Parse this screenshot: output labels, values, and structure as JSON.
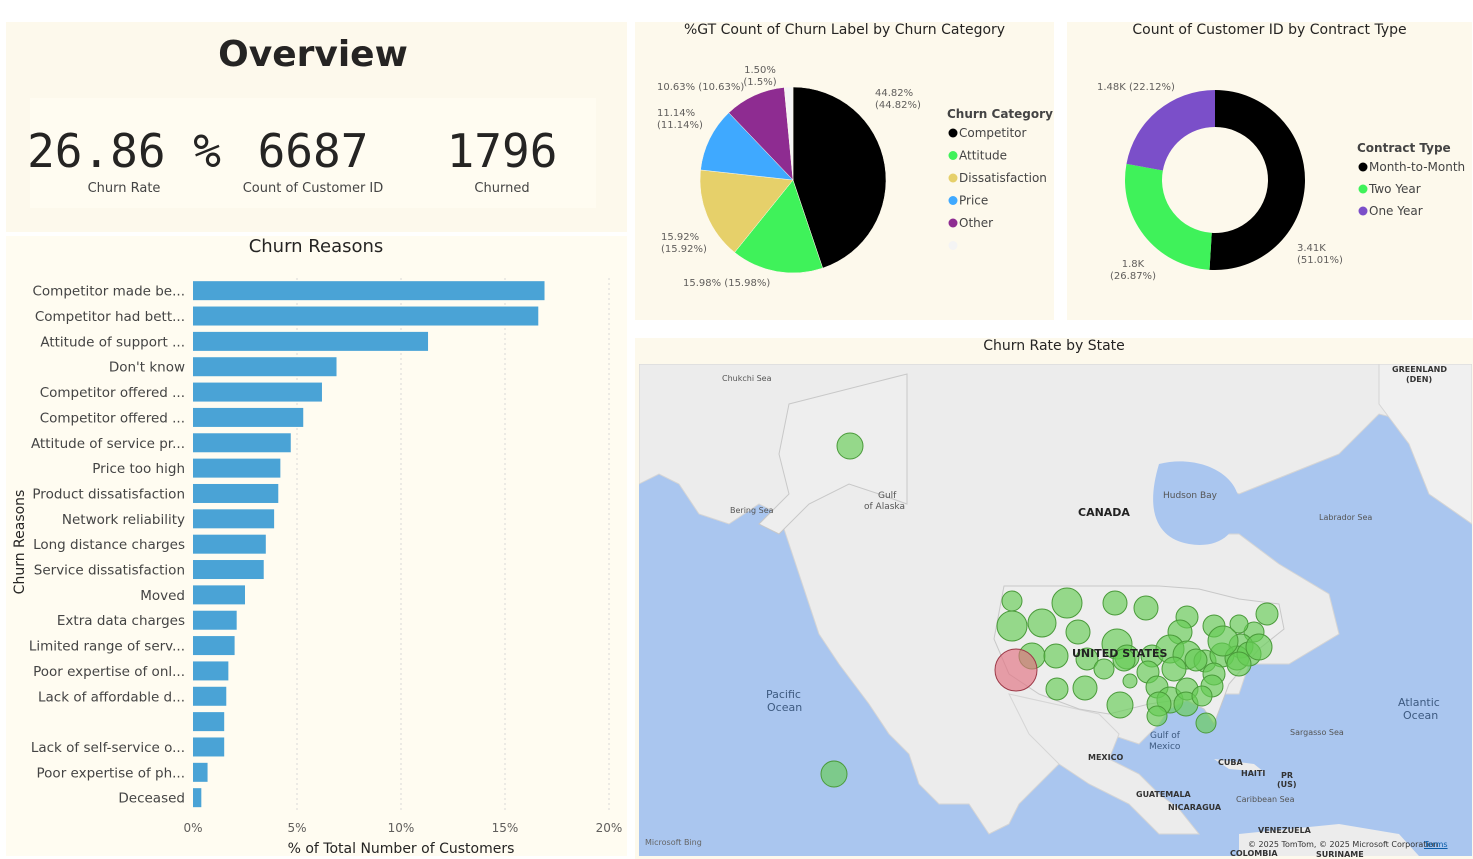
{
  "overview": {
    "title": "Overview",
    "kpis": [
      {
        "value": "26.86 %",
        "label": "Churn Rate"
      },
      {
        "value": "6687",
        "label": "Count of Customer ID"
      },
      {
        "value": "1796",
        "label": "Churned"
      }
    ]
  },
  "churn_reasons_chart": {
    "title": "Churn Reasons",
    "ylabel": "Churn Reasons",
    "xlabel": "% of Total Number of Customers",
    "color": "#4aa3d6"
  },
  "churn_category_chart": {
    "title": "%GT Count of Churn Label by Churn Category",
    "legend_title": "Churn Category"
  },
  "contract_chart": {
    "title": "Count of Customer ID by Contract Type",
    "legend_title": "Contract Type"
  },
  "map": {
    "title": "Churn Rate by State",
    "labels": {
      "chukchi": "Chukchi Sea",
      "greenland": "GREENLAND",
      "greenland2": "(DEN)",
      "gulf_alaska": "Gulf",
      "gulf_alaska2": "of Alaska",
      "bering": "Bering Sea",
      "hudson": "Hudson Bay",
      "canada": "CANADA",
      "labrador": "Labrador Sea",
      "us": "UNITED STATES",
      "pacific": "Pacific",
      "pacific2": "Ocean",
      "atlantic": "Atlantic",
      "atlantic2": "Ocean",
      "sargasso": "Sargasso Sea",
      "gulf_mexico": "Gulf of",
      "gulf_mexico2": "Mexico",
      "mexico": "MEXICO",
      "cuba": "CUBA",
      "haiti": "HAITI",
      "pr": "PR",
      "pr2": "(US)",
      "guatemala": "GUATEMALA",
      "nicaragua": "NICARAGUA",
      "caribbean": "Caribbean Sea",
      "venezuela": "VENEZUELA",
      "colombia": "COLOMBIA",
      "suriname": "SURINAME",
      "bing": "Microsoft Bing",
      "copyright": "© 2025 TomTom, © 2025 Microsoft Corporation",
      "terms": "Terms"
    }
  },
  "chart_data": [
    {
      "type": "bar",
      "orientation": "horizontal",
      "title": "Churn Reasons",
      "xlabel": "% of Total Number of Customers",
      "ylabel": "Churn Reasons",
      "xlim": [
        0,
        20
      ],
      "xticks": [
        "0%",
        "5%",
        "10%",
        "15%",
        "20%"
      ],
      "grid": true,
      "categories": [
        "Competitor made be...",
        "Competitor had bett...",
        "Attitude of support ...",
        "Don't know",
        "Competitor offered ...",
        "Competitor offered ...",
        "Attitude of service pr...",
        "Price too high",
        "Product dissatisfaction",
        "Network reliability",
        "Long distance charges",
        "Service dissatisfaction",
        "Moved",
        "Extra data charges",
        "Limited range of serv...",
        "Poor expertise of onl...",
        "Lack of affordable d...",
        "",
        "Lack of self-service o...",
        "Poor expertise of ph...",
        "Deceased"
      ],
      "values": [
        16.9,
        16.6,
        11.3,
        6.9,
        6.2,
        5.3,
        4.7,
        4.2,
        4.1,
        3.9,
        3.5,
        3.4,
        2.5,
        2.1,
        2.0,
        1.7,
        1.6,
        1.5,
        1.5,
        0.7,
        0.4
      ]
    },
    {
      "type": "pie",
      "title": "%GT Count of Churn Label by Churn Category",
      "legend_title": "Churn Category",
      "legend_position": "right",
      "slices": [
        {
          "name": "Competitor",
          "value": 44.82,
          "color": "#000000",
          "label": "44.82%\n(44.82%)"
        },
        {
          "name": "Attitude",
          "value": 15.98,
          "color": "#3ff25a",
          "label": "15.98% (15.98%)"
        },
        {
          "name": "Dissatisfaction",
          "value": 15.92,
          "color": "#e6d06a",
          "label": "15.92%\n(15.92%)"
        },
        {
          "name": "Price",
          "value": 11.14,
          "color": "#3fa9ff",
          "label": "11.14%\n(11.14%)"
        },
        {
          "name": "Other",
          "value": 10.63,
          "color": "#8e2c91",
          "label": "10.63% (10.63%)"
        },
        {
          "name": "",
          "value": 1.5,
          "color": "#f4f4f4",
          "label": "1.50%\n(1.5%)"
        }
      ]
    },
    {
      "type": "pie",
      "subtype": "donut",
      "title": "Count of Customer ID by Contract Type",
      "legend_title": "Contract Type",
      "legend_position": "right",
      "slices": [
        {
          "name": "Month-to-Month",
          "value": 3410,
          "percent": 51.01,
          "color": "#000000",
          "label": "3.41K\n(51.01%)"
        },
        {
          "name": "Two Year",
          "value": 1800,
          "percent": 26.87,
          "color": "#3ff25a",
          "label": "1.8K\n(26.87%)"
        },
        {
          "name": "One Year",
          "value": 1480,
          "percent": 22.12,
          "color": "#7b4fc9",
          "label": "1.48K (22.12%)"
        }
      ]
    }
  ]
}
